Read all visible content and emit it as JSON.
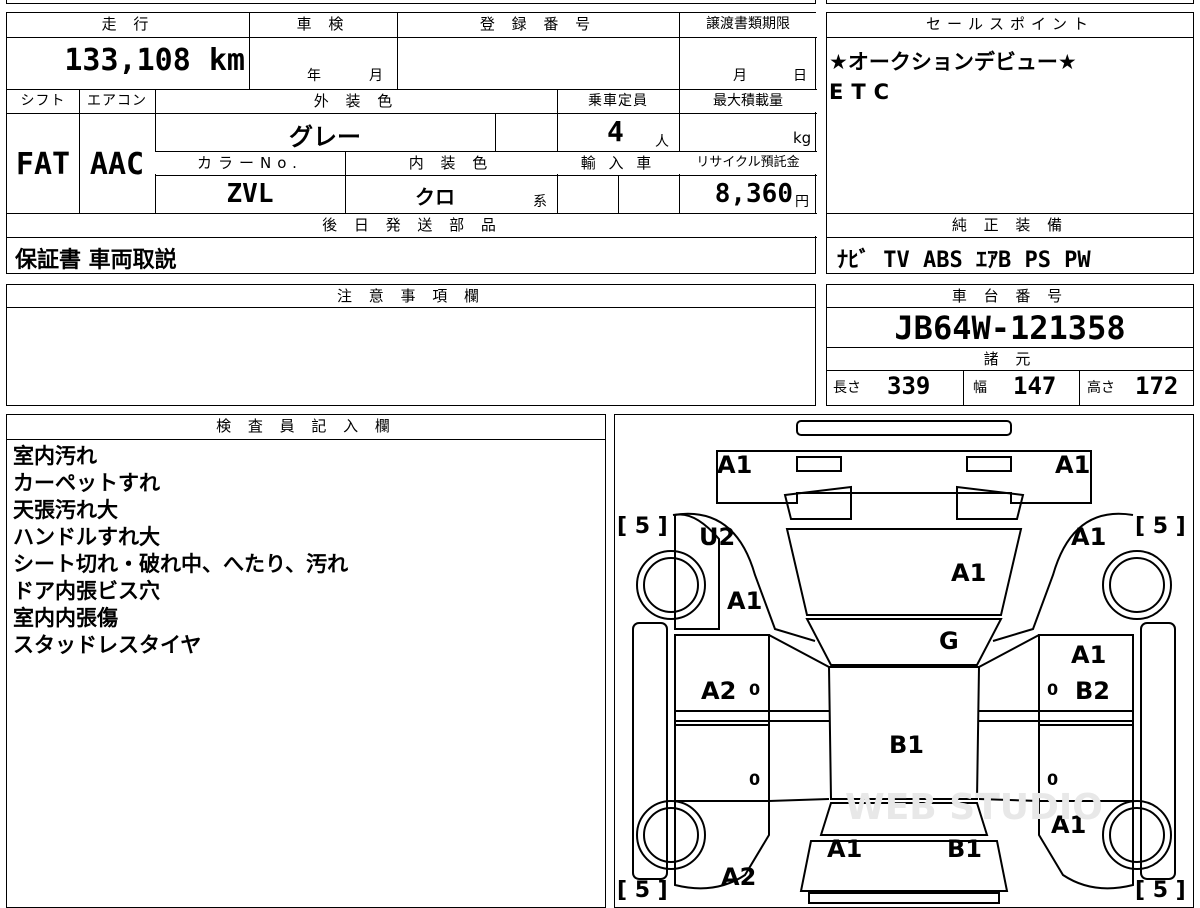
{
  "headers": {
    "mileage": "走 行",
    "shaken": "車 検",
    "registration": "登 録 番 号",
    "transfer_deadline": "譲渡書類期限",
    "sales_point": "セールスポイント",
    "shift": "シフト",
    "aircon": "エアコン",
    "exterior_color": "外 装 色",
    "capacity": "乗車定員",
    "max_load": "最大積載量",
    "color_no": "カラーNo.",
    "interior_color": "内 装 色",
    "import": "輸 入 車",
    "recycle": "リサイクル預託金",
    "parts_later": "後 日 発 送 部 品",
    "genuine_equipment": "純 正 装 備",
    "notes": "注 意 事 項 欄",
    "chassis": "車 台 番 号",
    "specs": "諸 元",
    "inspector": "検 査 員 記 入 欄"
  },
  "values": {
    "mileage": "133,108",
    "mileage_unit": "km",
    "shaken_year_unit": "年",
    "shaken_month_unit": "月",
    "deadline_month_unit": "月",
    "deadline_day_unit": "日",
    "shift": "FAT",
    "aircon": "AAC",
    "exterior_color": "グレー",
    "capacity": "4",
    "capacity_unit": "人",
    "max_load_unit": "kg",
    "color_no": "ZVL",
    "interior_color": "クロ",
    "interior_suffix": "系",
    "recycle": "8,360",
    "recycle_unit": "円",
    "parts_later": "保証書 車両取説",
    "genuine_equipment": "ﾅﾋﾞ TV ABS ｴｱB PS PW",
    "chassis": "JB64W-121358",
    "length_label": "長さ",
    "length": "339",
    "width_label": "幅",
    "width": "147",
    "height_label": "高さ",
    "height": "172"
  },
  "sales_points": [
    "★オークションデビュー★",
    "ETC"
  ],
  "inspector_notes": [
    "室内汚れ",
    "カーペットすれ",
    "天張汚れ大",
    "ハンドルすれ大",
    "シート切れ・破れ中、へたり、汚れ",
    "ドア内張ビス穴",
    "室内内張傷",
    "スタッドレスタイヤ"
  ],
  "diagram": {
    "tire_left_top": "[ 5 ]",
    "tire_right_top": "[ 5 ]",
    "tire_left_bottom": "[ 5 ]",
    "tire_right_bottom": "[ 5 ]",
    "front_left": "A1",
    "front_right": "A1",
    "fender_fl": "U2",
    "fender_fr": "A1",
    "hood": "A1",
    "pillar_fl": "A1",
    "windshield": "G",
    "door_fr": "A1",
    "door_fl": "A2",
    "door_rr": "B2",
    "roof": "B1",
    "rear_fr": "A1",
    "rear_left": "A1",
    "rear_right": "B1",
    "rear_bottom": "A2",
    "zero_fl": "0",
    "zero_fr": "0",
    "zero_rl": "0",
    "zero_rr": "0",
    "watermark": "WEB STUDIO"
  }
}
